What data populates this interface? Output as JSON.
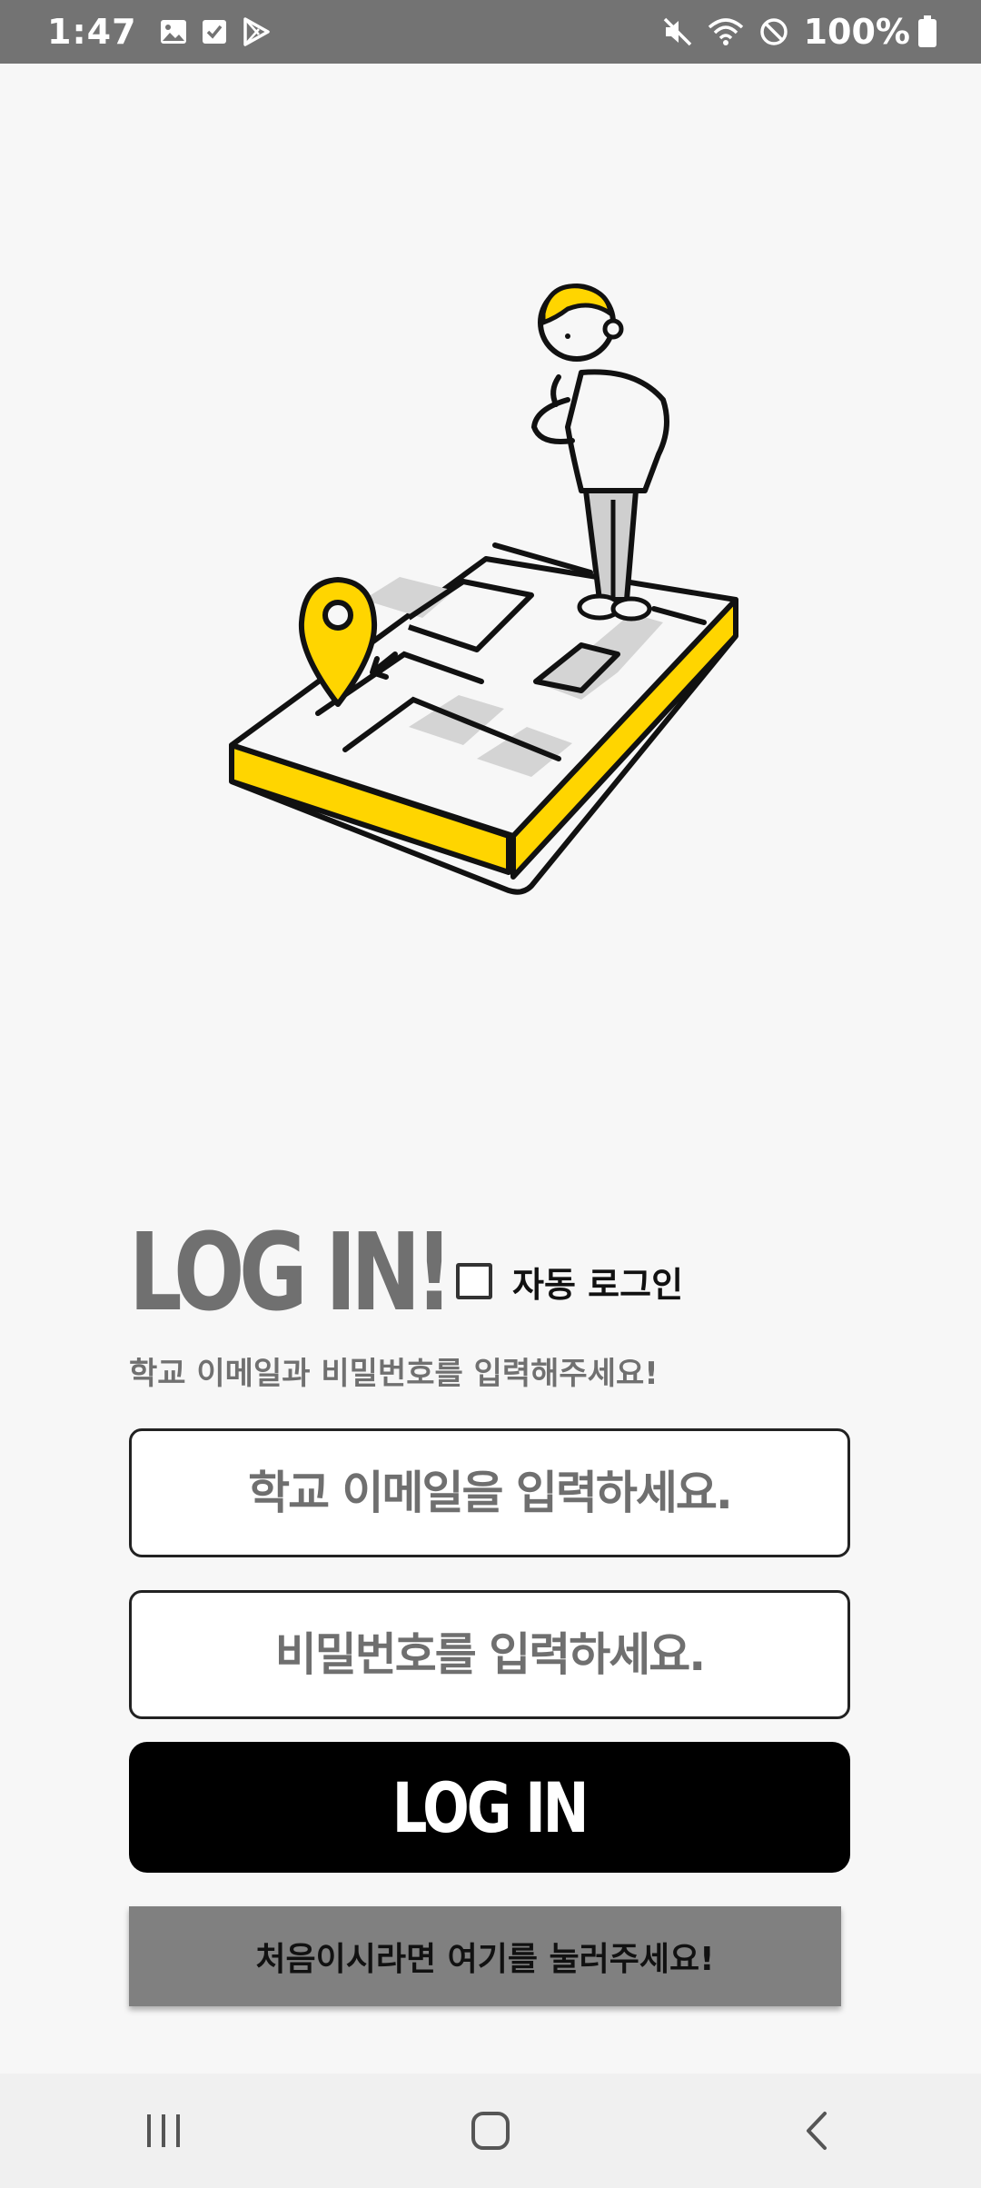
{
  "status_bar": {
    "time": "1:47",
    "battery": "100%",
    "left_icons": [
      "image-icon",
      "check-icon",
      "play-store-icon"
    ],
    "right_icons": [
      "mute-icon",
      "wifi-icon",
      "do-not-disturb-icon",
      "battery-icon"
    ]
  },
  "login": {
    "title": "LOG IN!",
    "auto_login_label": "자동 로그인",
    "subtitle": "학교 이메일과 비밀번호를 입력해주세요!",
    "email_placeholder": "학교 이메일을 입력하세요.",
    "password_placeholder": "비밀번호를 입력하세요.",
    "login_button": "LOG IN",
    "signup_link": "처음이시라면 여기를 눌러주세요!"
  },
  "colors": {
    "accent_yellow": "#FFD500",
    "title_gray": "#707070",
    "status_bar": "#737373",
    "button_black": "#000000",
    "signup_gray": "#808080"
  }
}
